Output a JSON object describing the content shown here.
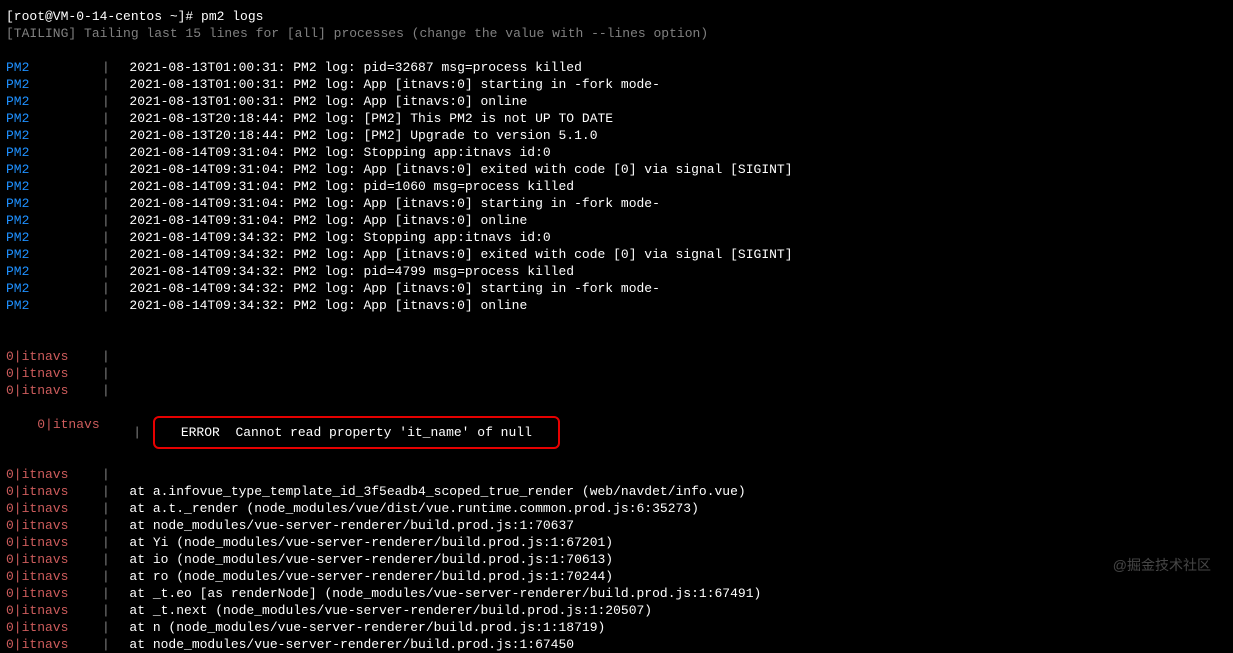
{
  "prompt": "[root@VM-0-14-centos ~]# pm2 logs",
  "tailing": "[TAILING] Tailing last 15 lines for [all] processes (change the value with --lines option)",
  "pm2_app": "PM2",
  "sep": "|",
  "logs": [
    "2021-08-13T01:00:31: PM2 log: pid=32687 msg=process killed",
    "2021-08-13T01:00:31: PM2 log: App [itnavs:0] starting in -fork mode-",
    "2021-08-13T01:00:31: PM2 log: App [itnavs:0] online",
    "2021-08-13T20:18:44: PM2 log: [PM2] This PM2 is not UP TO DATE",
    "2021-08-13T20:18:44: PM2 log: [PM2] Upgrade to version 5.1.0",
    "2021-08-14T09:31:04: PM2 log: Stopping app:itnavs id:0",
    "2021-08-14T09:31:04: PM2 log: App [itnavs:0] exited with code [0] via signal [SIGINT]",
    "2021-08-14T09:31:04: PM2 log: pid=1060 msg=process killed",
    "2021-08-14T09:31:04: PM2 log: App [itnavs:0] starting in -fork mode-",
    "2021-08-14T09:31:04: PM2 log: App [itnavs:0] online",
    "2021-08-14T09:34:32: PM2 log: Stopping app:itnavs id:0",
    "2021-08-14T09:34:32: PM2 log: App [itnavs:0] exited with code [0] via signal [SIGINT]",
    "2021-08-14T09:34:32: PM2 log: pid=4799 msg=process killed",
    "2021-08-14T09:34:32: PM2 log: App [itnavs:0] starting in -fork mode-",
    "2021-08-14T09:34:32: PM2 log: App [itnavs:0] online"
  ],
  "err_app": "0|itnavs",
  "error_highlight": " ERROR  Cannot read property 'it_name' of null ",
  "err_blank_count": 3,
  "stack": [
    "  at a.infovue_type_template_id_3f5eadb4_scoped_true_render (web/navdet/info.vue)",
    "  at a.t._render (node_modules/vue/dist/vue.runtime.common.prod.js:6:35273)",
    "  at node_modules/vue-server-renderer/build.prod.js:1:70637",
    "  at Yi (node_modules/vue-server-renderer/build.prod.js:1:67201)",
    "  at io (node_modules/vue-server-renderer/build.prod.js:1:70613)",
    "  at ro (node_modules/vue-server-renderer/build.prod.js:1:70244)",
    "  at _t.eo [as renderNode] (node_modules/vue-server-renderer/build.prod.js:1:67491)",
    "  at _t.next (node_modules/vue-server-renderer/build.prod.js:1:20507)",
    "  at n (node_modules/vue-server-renderer/build.prod.js:1:18719)",
    "  at node_modules/vue-server-renderer/build.prod.js:1:67450"
  ],
  "watermark": "@掘金技术社区"
}
